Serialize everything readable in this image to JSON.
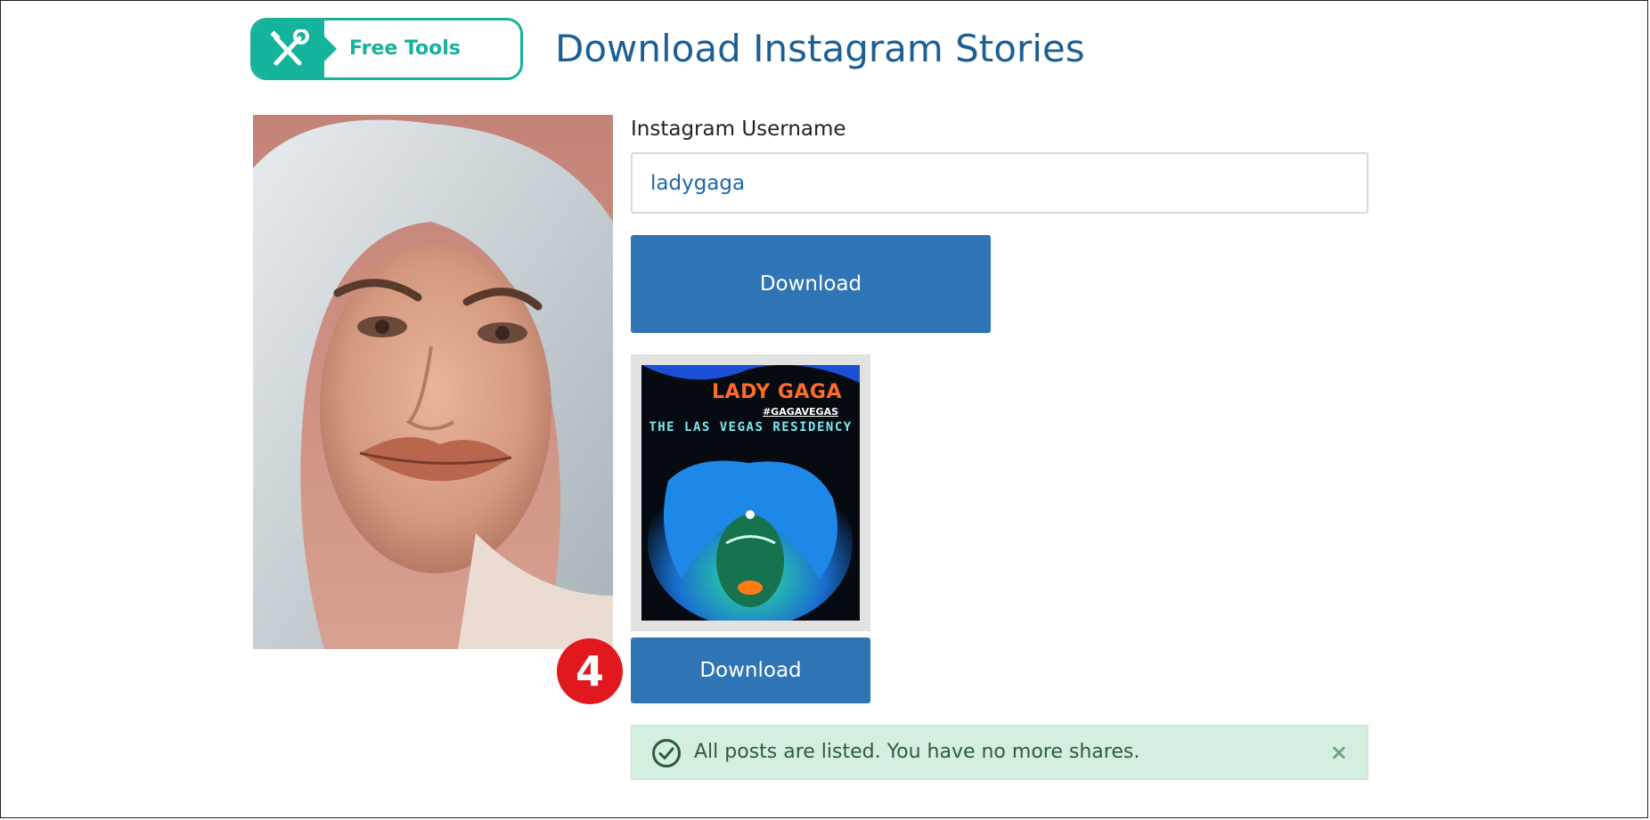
{
  "header": {
    "badge_label": "Free Tools",
    "badge_icon": "wrench-screwdriver-icon",
    "title": "Download Instagram Stories"
  },
  "form": {
    "username_label": "Instagram Username",
    "username_value": "ladygaga",
    "download_label": "Download"
  },
  "story": {
    "title_text": "LADY GAGA",
    "tag_text": "#GAGAVEGAS",
    "subtitle_text": "THE LAS VEGAS RESIDENCY",
    "download_label": "Download"
  },
  "step_marker": "4",
  "alert": {
    "icon": "check-circle-icon",
    "message": "All posts are listed. You have no more shares.",
    "close_label": "×"
  },
  "colors": {
    "brand_teal": "#14b39c",
    "title_blue": "#1c5f94",
    "button_blue": "#2f74b4",
    "marker_red": "#e1191e",
    "alert_bg": "#d4efdf"
  }
}
